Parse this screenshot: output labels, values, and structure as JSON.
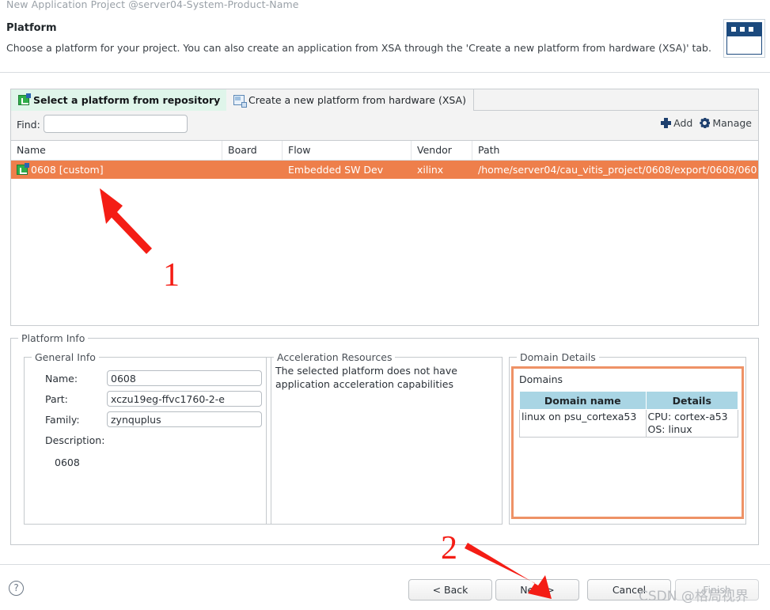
{
  "window": {
    "title": "New Application Project @server04-System-Product-Name",
    "banner_icon": "dialog-banner-icon"
  },
  "page": {
    "title": "Platform",
    "description": "Choose a platform for your project. You can also create an application from XSA through the 'Create a new platform from hardware (XSA)' tab."
  },
  "tabs": [
    {
      "label": "Select a platform from repository",
      "icon": "platform-icon",
      "active": true
    },
    {
      "label": "Create a new platform from hardware (XSA)",
      "icon": "xsa-icon",
      "active": false
    }
  ],
  "find": {
    "label": "Find:",
    "value": "",
    "placeholder": ""
  },
  "toolbar": {
    "add_label": "Add",
    "add_icon": "plus-icon",
    "manage_label": "Manage",
    "manage_icon": "gear-icon"
  },
  "table": {
    "columns": [
      "Name",
      "Board",
      "Flow",
      "Vendor",
      "Path"
    ],
    "rows": [
      {
        "name": "0608 [custom]",
        "board": "",
        "flow": "Embedded SW Dev",
        "vendor": "xilinx",
        "path": "/home/server04/cau_vitis_project/0608/export/0608/060",
        "selected": true,
        "icon": "platform-icon"
      }
    ]
  },
  "platform_info": {
    "legend": "Platform Info",
    "general_info": {
      "legend": "General Info",
      "fields": [
        {
          "label": "Name:",
          "value": "0608"
        },
        {
          "label": "Part:",
          "value": "xczu19eg-ffvc1760-2-e"
        },
        {
          "label": "Family:",
          "value": "zynquplus"
        }
      ],
      "description_label": "Description:",
      "description_value": "0608"
    },
    "acceleration_resources": {
      "legend": "Acceleration Resources",
      "message": "The selected platform does not have application acceleration capabilities"
    },
    "domain_details": {
      "legend": "Domain Details",
      "domains_label": "Domains",
      "columns": [
        "Domain name",
        "Details"
      ],
      "rows": [
        {
          "domain_name": "linux on psu_cortexa53",
          "details_cpu": "CPU: cortex-a53",
          "details_os": "OS: linux"
        }
      ]
    }
  },
  "footer": {
    "help_icon": "help-icon",
    "help_glyph": "?",
    "buttons": [
      {
        "label": "< Back",
        "enabled": true
      },
      {
        "label": "Next >",
        "enabled": true
      },
      {
        "label": "Cancel",
        "enabled": true
      },
      {
        "label": "Finish",
        "enabled": false
      }
    ]
  },
  "annotations": {
    "marker_1": "1",
    "marker_2": "2",
    "arrow_color": "#f41d15"
  },
  "watermark": "CSDN @格局视界",
  "colors": {
    "selection": "#ee7f4b",
    "active_tab": "#dff5ea",
    "domain_header": "#a9d5e4",
    "focus_border": "#ee9266",
    "banner_blue": "#1c4a7e",
    "platform_icon_green": "#2fae4a"
  }
}
